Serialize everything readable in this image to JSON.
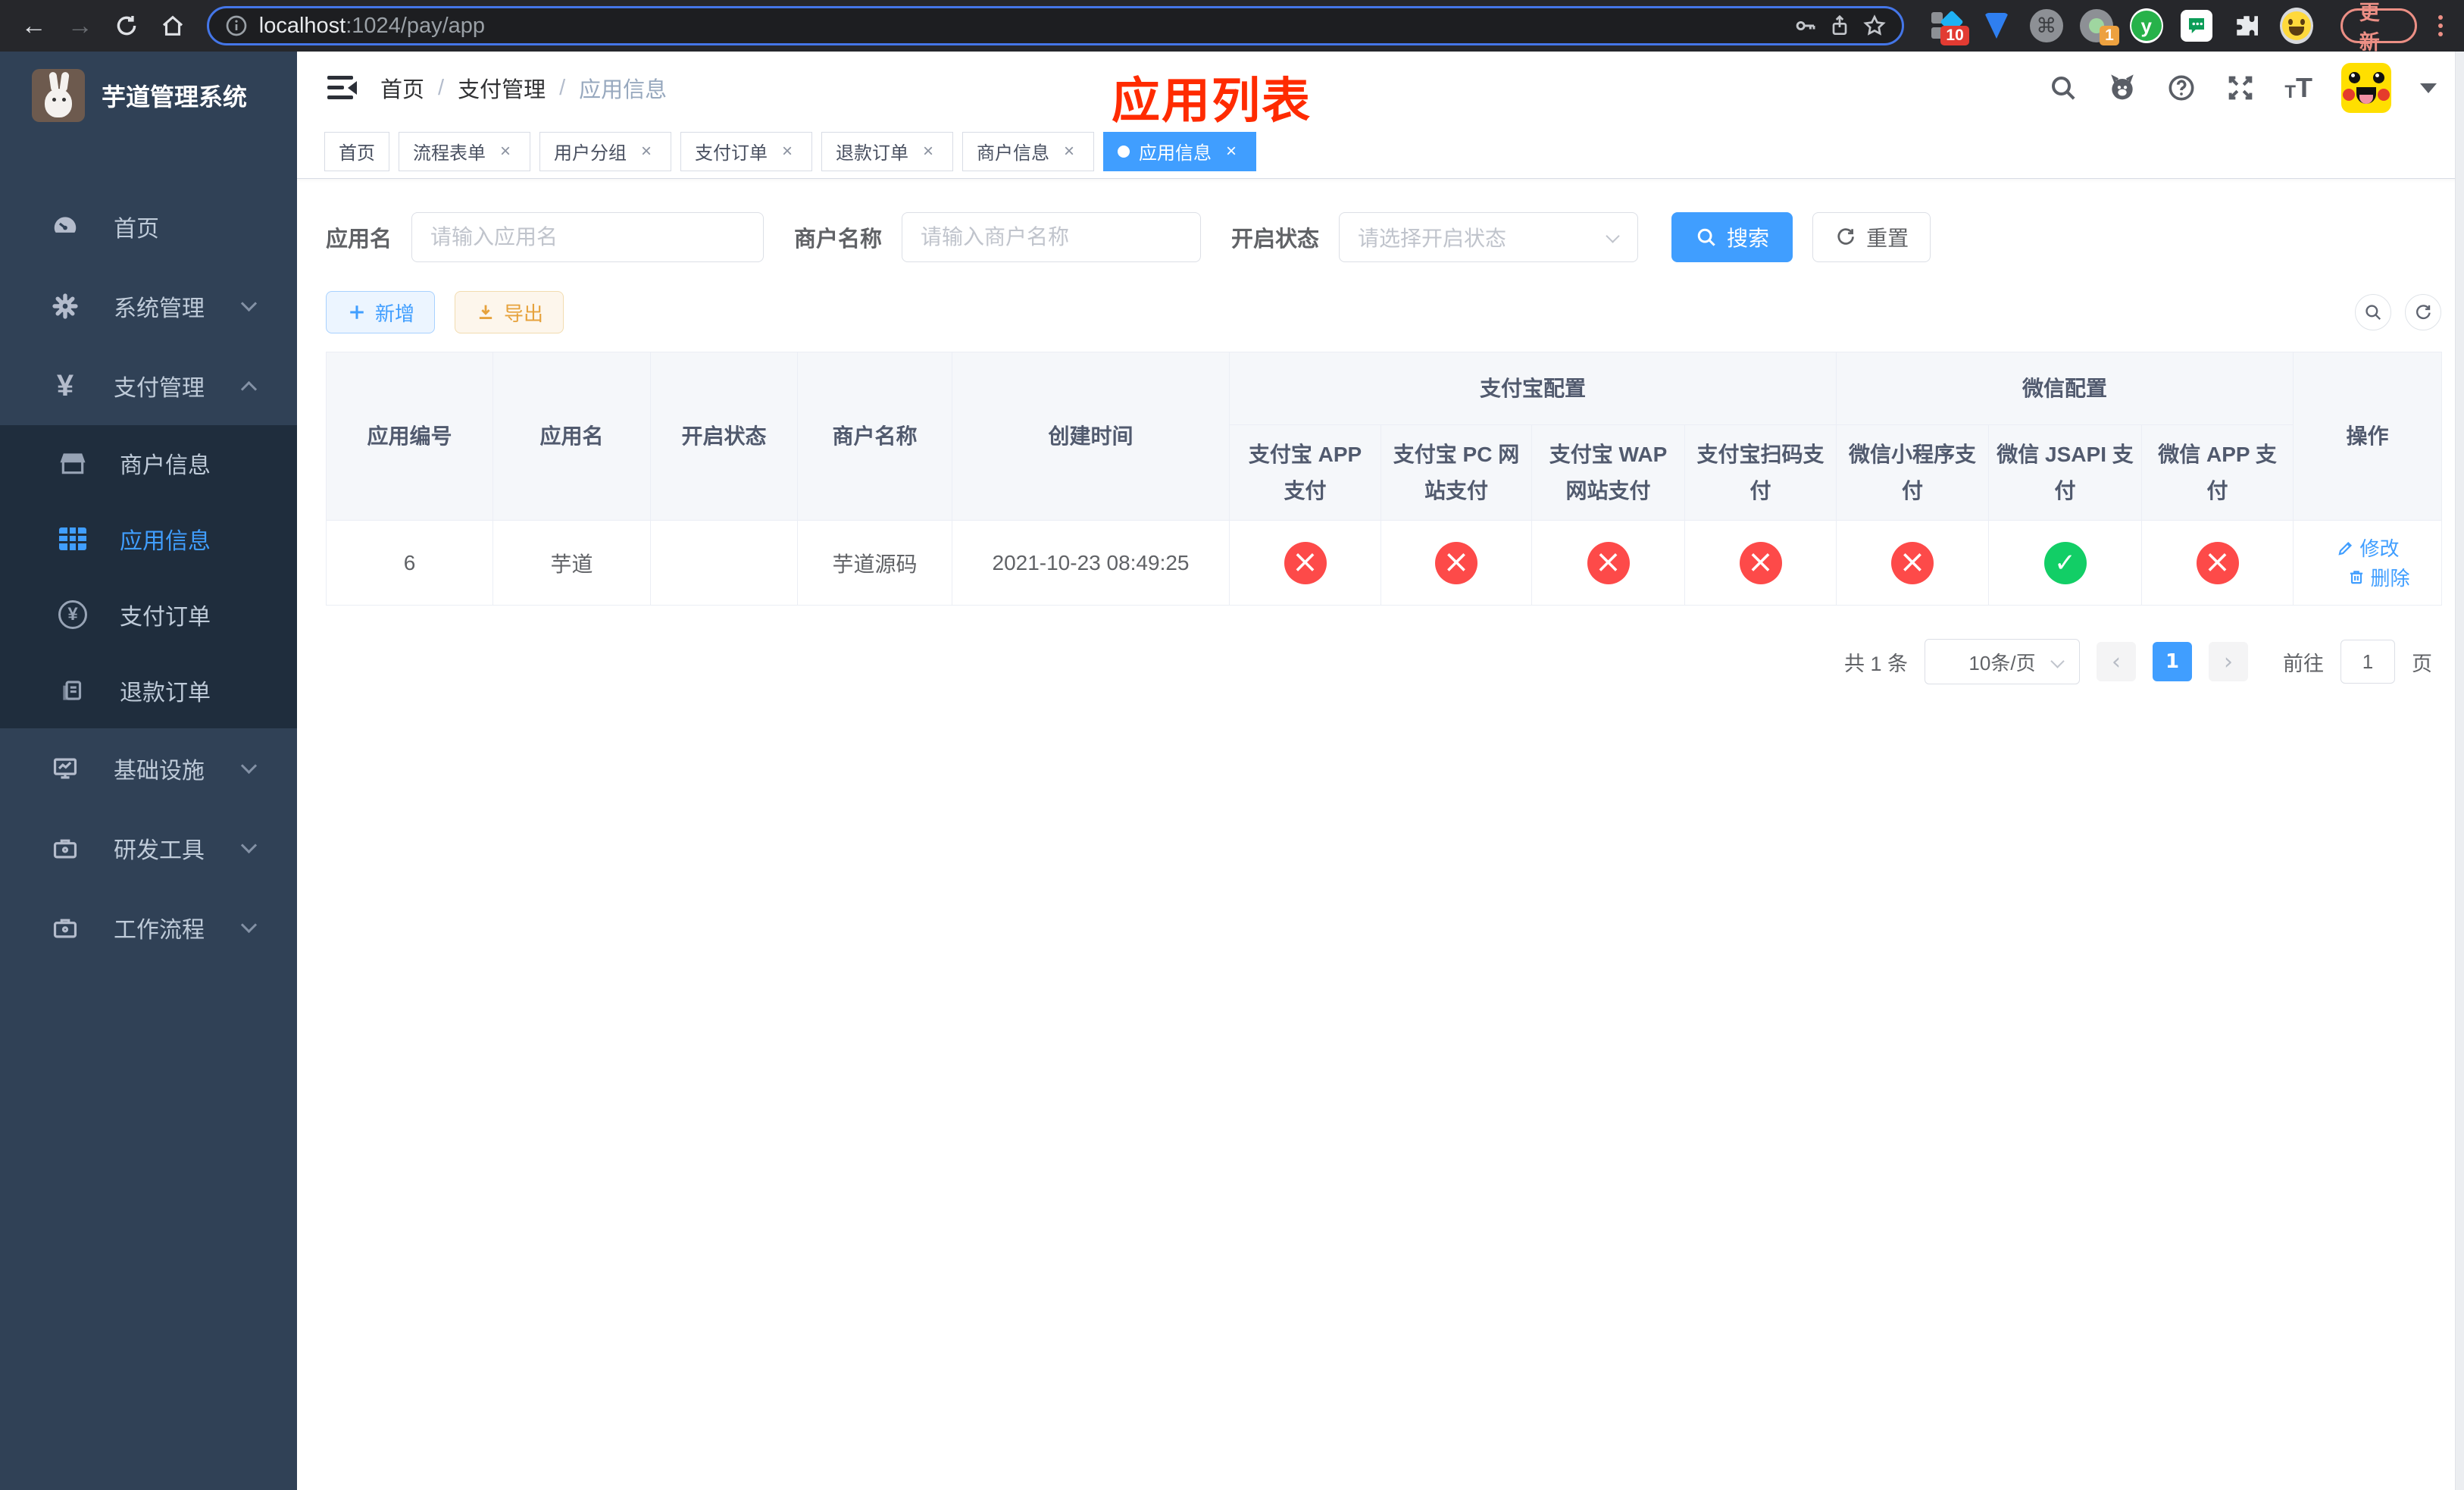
{
  "browser": {
    "url_host": "localhost",
    "url_rest": ":1024/pay/app",
    "update_label": "更新",
    "ext_badge_1": "10",
    "ext_badge_2": "1",
    "ext_letter": "y"
  },
  "sidebar": {
    "app_title": "芋道管理系统",
    "items": [
      {
        "label": "首页"
      },
      {
        "label": "系统管理"
      },
      {
        "label": "支付管理"
      },
      {
        "label": "基础设施"
      },
      {
        "label": "研发工具"
      },
      {
        "label": "工作流程"
      }
    ],
    "sub_items": [
      {
        "label": "商户信息"
      },
      {
        "label": "应用信息"
      },
      {
        "label": "支付订单"
      },
      {
        "label": "退款订单"
      }
    ]
  },
  "header": {
    "breadcrumb": [
      {
        "label": "首页"
      },
      {
        "label": "支付管理"
      },
      {
        "label": "应用信息"
      }
    ],
    "overlay_title": "应用列表"
  },
  "tabs": [
    {
      "label": "首页"
    },
    {
      "label": "流程表单"
    },
    {
      "label": "用户分组"
    },
    {
      "label": "支付订单"
    },
    {
      "label": "退款订单"
    },
    {
      "label": "商户信息"
    },
    {
      "label": "应用信息"
    }
  ],
  "filters": {
    "app_name_label": "应用名",
    "app_name_placeholder": "请输入应用名",
    "merchant_label": "商户名称",
    "merchant_placeholder": "请输入商户名称",
    "status_label": "开启状态",
    "status_placeholder": "请选择开启状态",
    "search_label": "搜索",
    "reset_label": "重置"
  },
  "toolbar": {
    "add_label": "新增",
    "export_label": "导出"
  },
  "table": {
    "groups": {
      "alipay": "支付宝配置",
      "wechat": "微信配置"
    },
    "columns": {
      "id": "应用编号",
      "name": "应用名",
      "status": "开启状态",
      "merchant": "商户名称",
      "created": "创建时间",
      "alipay_app": "支付宝 APP 支付",
      "alipay_pc": "支付宝 PC 网站支付",
      "alipay_wap": "支付宝 WAP 网站支付",
      "alipay_qr": "支付宝扫码支付",
      "wx_mini": "微信小程序支付",
      "wx_jsapi": "微信 JSAPI 支付",
      "wx_app": "微信 APP 支付",
      "actions": "操作"
    },
    "row": {
      "id": "6",
      "name": "芋道",
      "enabled_state": "on",
      "merchant": "芋道源码",
      "created": "2021-10-23 08:49:25",
      "statuses": [
        "fail",
        "fail",
        "fail",
        "fail",
        "fail",
        "success",
        "fail"
      ],
      "edit_label": "修改",
      "delete_label": "删除"
    }
  },
  "pagination": {
    "total": "共 1 条",
    "page_size": "10条/页",
    "page": "1",
    "goto_label": "前往",
    "goto_value": "1",
    "page_unit": "页"
  }
}
